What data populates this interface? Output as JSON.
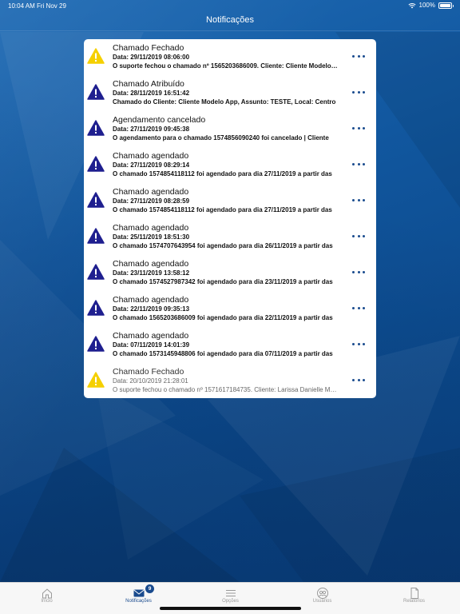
{
  "status": {
    "time": "10:04 AM",
    "date": "Fri Nov 29",
    "battery": "100%"
  },
  "nav": {
    "title": "Notificações"
  },
  "colors": {
    "accent": "#1a4b8e",
    "warning": "#f5d000",
    "info": "#1f1f8f"
  },
  "notifications": [
    {
      "kind": "warning",
      "title": "Chamado Fechado",
      "date": "Data: 29/11/2019 08:06:00",
      "description": "O suporte fechou o chamado nº 1565203686009. Cliente: Cliente Modelo App",
      "read": false
    },
    {
      "kind": "info",
      "title": "Chamado Atribuído",
      "date": "Data: 28/11/2019 16:51:42",
      "description": "Chamado do Cliente: Cliente Modelo App, Assunto: TESTE, Local: Centro",
      "read": false
    },
    {
      "kind": "info",
      "title": "Agendamento cancelado",
      "date": "Data: 27/11/2019 09:45:38",
      "description": "O agendamento para o chamado 1574856090240 foi cancelado | Cliente",
      "read": false
    },
    {
      "kind": "info",
      "title": "Chamado agendado",
      "date": "Data: 27/11/2019 08:29:14",
      "description": "O chamado 1574854118112 foi agendado para dia 27/11/2019 a partir das",
      "read": false
    },
    {
      "kind": "info",
      "title": "Chamado agendado",
      "date": "Data: 27/11/2019 08:28:59",
      "description": "O chamado 1574854118112 foi agendado para dia 27/11/2019 a partir das",
      "read": false
    },
    {
      "kind": "info",
      "title": "Chamado agendado",
      "date": "Data: 25/11/2019 18:51:30",
      "description": "O chamado 1574707643954 foi agendado para dia 26/11/2019 a partir das",
      "read": false
    },
    {
      "kind": "info",
      "title": "Chamado agendado",
      "date": "Data: 23/11/2019 13:58:12",
      "description": "O chamado 1574527987342 foi agendado para dia 23/11/2019 a partir das",
      "read": false
    },
    {
      "kind": "info",
      "title": "Chamado agendado",
      "date": "Data: 22/11/2019 09:35:13",
      "description": "O chamado 1565203686009 foi agendado para dia 22/11/2019 a partir das",
      "read": false
    },
    {
      "kind": "info",
      "title": "Chamado agendado",
      "date": "Data: 07/11/2019 14:01:39",
      "description": "O chamado 1573145948806 foi agendado para dia 07/11/2019 a partir das",
      "read": false
    },
    {
      "kind": "warning",
      "title": "Chamado Fechado",
      "date": "Data: 20/10/2019 21:28:01",
      "description": "O suporte fechou o chamado nº 1571617184735. Cliente: Larissa Danielle Medeiros",
      "read": true
    }
  ],
  "tabs": [
    {
      "label": "Início",
      "icon": "home-icon",
      "active": false
    },
    {
      "label": "Notificações",
      "icon": "envelope-icon",
      "active": true,
      "badge": "9"
    },
    {
      "label": "Opções",
      "icon": "menu-icon",
      "active": false
    },
    {
      "label": "Usuários",
      "icon": "users-icon",
      "active": false
    },
    {
      "label": "Relatórios",
      "icon": "document-icon",
      "active": false
    }
  ]
}
